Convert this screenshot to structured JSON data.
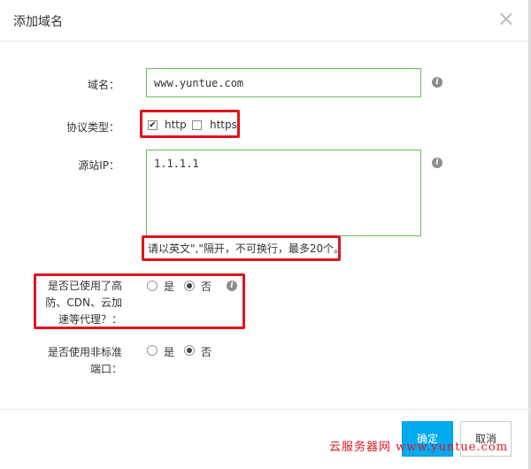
{
  "dialog": {
    "title": "添加域名",
    "close_glyph": "×"
  },
  "form": {
    "domain": {
      "label": "域名：",
      "value": "www.yuntue.com",
      "info": "i"
    },
    "protocol": {
      "label": "协议类型：",
      "options": [
        {
          "label": "http",
          "checked": true
        },
        {
          "label": "https",
          "checked": false
        }
      ]
    },
    "origin_ip": {
      "label": "源站IP：",
      "value": "1.1.1.1",
      "info": "i",
      "hint": "请以英文\",\"隔开，不可换行，最多20个。"
    },
    "proxy": {
      "label_lines": [
        "是否已使用了高",
        "防、CDN、云加",
        "速等代理？："
      ],
      "yes": "是",
      "no": "否",
      "selected": "否",
      "info": "i"
    },
    "nonstandard_port": {
      "label_lines": [
        "是否使用非标准",
        "端口："
      ],
      "yes": "是",
      "no": "否",
      "selected": "否"
    }
  },
  "footer": {
    "confirm": "确定",
    "cancel": "取消"
  },
  "watermark": "云服务器网 www.yuntue.com",
  "colors": {
    "accent": "#00aaee",
    "input_border": "#6bbf5a",
    "highlight": "#e0141e"
  }
}
